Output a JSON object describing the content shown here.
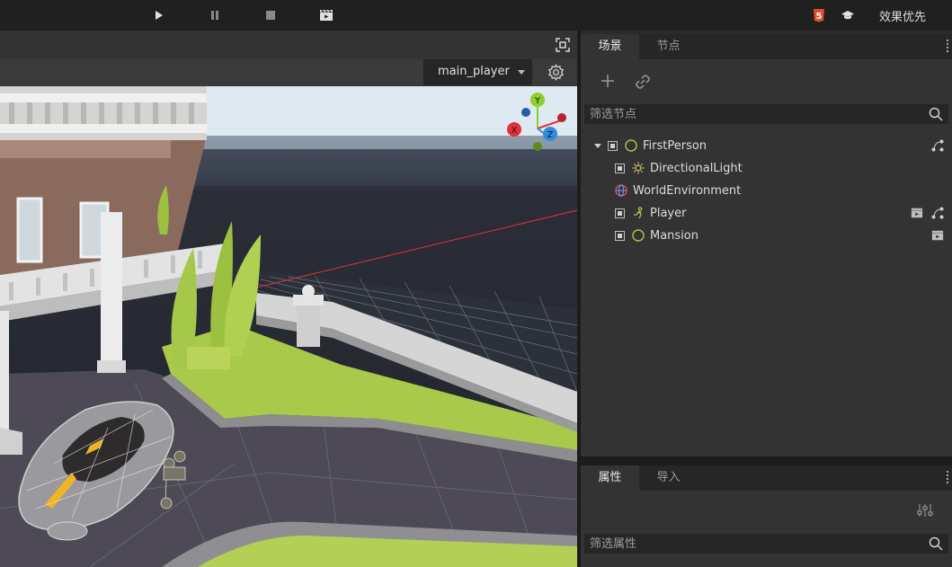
{
  "toolbar": {
    "play": "play-icon",
    "pause": "pause-icon",
    "stop": "stop-icon",
    "clapper": "clapperboard-icon",
    "html5": "html5-icon",
    "learn": "graduation-cap-icon",
    "quality_label": "效果优先",
    "html5_badge": "5"
  },
  "viewport": {
    "camera": "main_player",
    "gizmo": {
      "y": "Y",
      "x": "X",
      "z": "Z"
    }
  },
  "scene_panel": {
    "tabs": [
      "场景",
      "节点"
    ],
    "filter_placeholder": "筛选节点",
    "nodes": [
      {
        "label": "FirstPerson",
        "icon": "circle-node-icon"
      },
      {
        "label": "DirectionalLight",
        "icon": "sun-icon"
      },
      {
        "label": "WorldEnvironment",
        "icon": "globe-icon"
      },
      {
        "label": "Player",
        "icon": "person-icon"
      },
      {
        "label": "Mansion",
        "icon": "circle-node-icon"
      }
    ]
  },
  "inspector_panel": {
    "tabs": [
      "属性",
      "导入"
    ],
    "filter_placeholder": "筛选属性"
  },
  "colors": {
    "accent_green": "#a5c84a",
    "axis_x": "#e5303a",
    "axis_y": "#8ad12b",
    "axis_z": "#2d8de0",
    "html5_orange": "#e44d26"
  }
}
